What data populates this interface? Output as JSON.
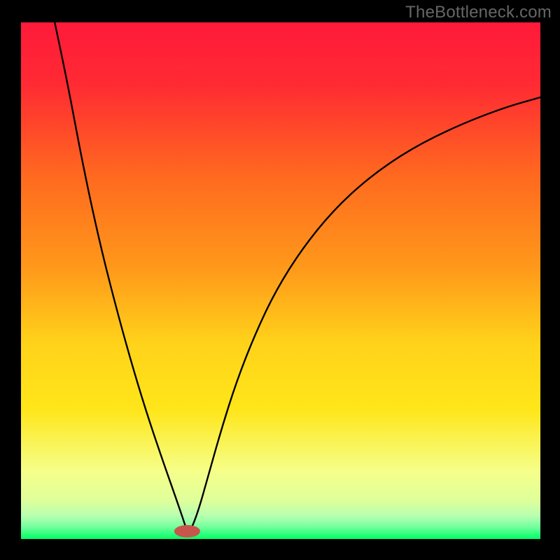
{
  "watermark": "TheBottleneck.com",
  "chart_data": {
    "type": "line",
    "title": "",
    "xlabel": "",
    "ylabel": "",
    "xlim": [
      0,
      100
    ],
    "ylim": [
      0,
      100
    ],
    "background_gradient": {
      "top": "#ff1a3a",
      "mid_upper": "#ff9a1a",
      "mid": "#ffe61a",
      "lower": "#f5ff8a",
      "bottom": "#00ff66"
    },
    "marker": {
      "x": 32,
      "y": 1.5,
      "color": "#c9544b",
      "rx": 2.5,
      "ry": 1.2
    },
    "series": [
      {
        "name": "left-branch",
        "x": [
          6.5,
          9,
          12,
          15,
          18,
          21,
          24,
          27,
          29.8,
          31.5,
          32
        ],
        "y": [
          100,
          88,
          72,
          58,
          46,
          35,
          25,
          16,
          8,
          3,
          1.3
        ]
      },
      {
        "name": "right-branch",
        "x": [
          32.5,
          34,
          36,
          38.5,
          41.5,
          45,
          49,
          54,
          60,
          67,
          75,
          84,
          93,
          100
        ],
        "y": [
          1.3,
          5,
          12,
          21,
          30.5,
          39.5,
          48,
          56,
          63.5,
          70,
          75.5,
          80,
          83.5,
          85.5
        ]
      }
    ]
  }
}
